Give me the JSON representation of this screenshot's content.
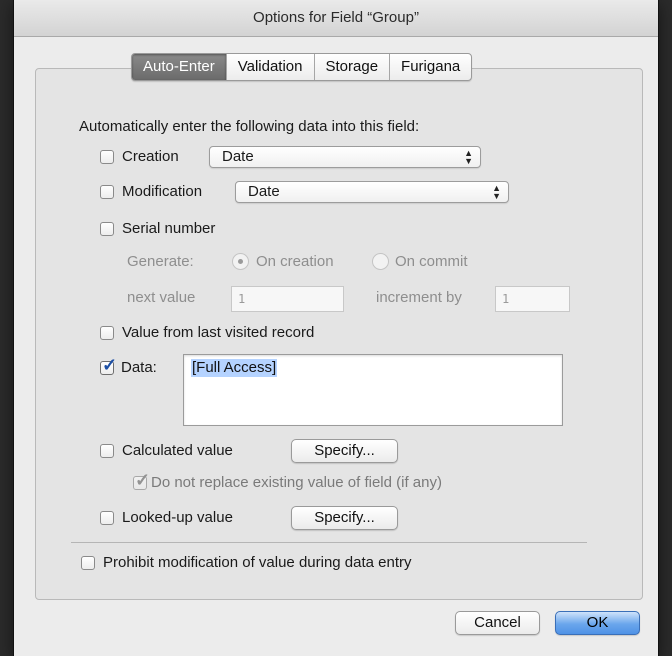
{
  "dialog": {
    "title": "Options for Field “Group”"
  },
  "tabs": [
    {
      "label": "Auto-Enter",
      "active": true
    },
    {
      "label": "Validation",
      "active": false
    },
    {
      "label": "Storage",
      "active": false
    },
    {
      "label": "Furigana",
      "active": false
    }
  ],
  "auto_enter": {
    "heading": "Automatically enter the following data into this field:",
    "creation": {
      "label": "Creation",
      "checked": false,
      "select_value": "Date"
    },
    "modification": {
      "label": "Modification",
      "checked": false,
      "select_value": "Date"
    },
    "serial": {
      "label": "Serial number",
      "checked": false,
      "generate_label": "Generate:",
      "on_creation": "On creation",
      "on_commit": "On commit",
      "next_value_label": "next value",
      "next_value": "1",
      "increment_label": "increment by",
      "increment": "1"
    },
    "last_visited": {
      "label": "Value from last visited record",
      "checked": false
    },
    "data": {
      "label": "Data:",
      "checked": true,
      "value": "[Full Access]"
    },
    "calculated": {
      "label": "Calculated value",
      "checked": false,
      "button": "Specify...",
      "do_not_replace": "Do not replace existing value of field (if any)",
      "do_not_replace_checked": true
    },
    "looked_up": {
      "label": "Looked-up value",
      "checked": false,
      "button": "Specify..."
    },
    "prohibit": {
      "label": "Prohibit modification of value during data entry",
      "checked": false
    }
  },
  "buttons": {
    "cancel": "Cancel",
    "ok": "OK"
  },
  "colors": {
    "accent": "#4f92e6",
    "selection": "#b5d3ff",
    "check": "#1d4fa5"
  }
}
